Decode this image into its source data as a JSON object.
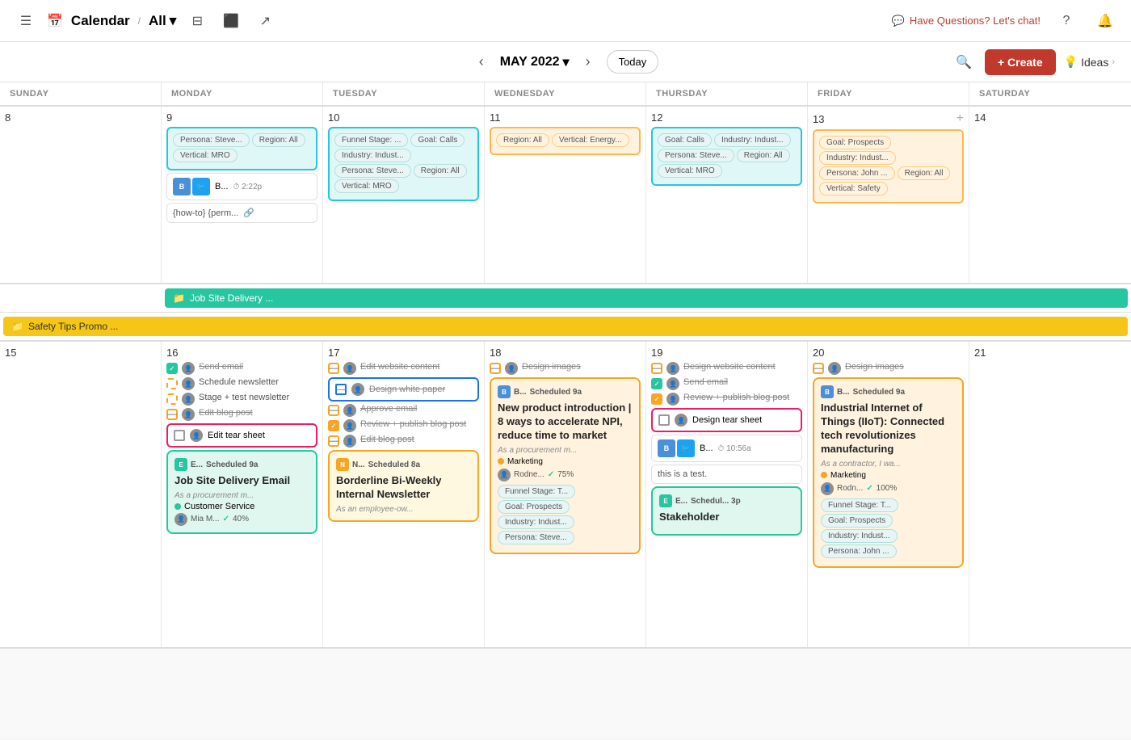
{
  "nav": {
    "menu_icon": "☰",
    "cal_icon": "▦",
    "title": "Calendar",
    "sep": "/",
    "all": "All",
    "chevron_down": "▾",
    "filter_icon": "⊟",
    "display_icon": "⬜",
    "share_icon": "↗",
    "chat_text": "Have Questions? Let's chat!",
    "help_icon": "?",
    "bell_icon": "🔔"
  },
  "controls": {
    "prev": "‹",
    "next": "›",
    "month_year": "MAY 2022",
    "today": "Today",
    "search_icon": "🔍",
    "create": "+ Create",
    "ideas_icon": "💡",
    "ideas": "Ideas"
  },
  "day_headers": [
    "SUNDAY",
    "MONDAY",
    "TUESDAY",
    "WEDNESDAY",
    "THURSDAY",
    "FRIDAY",
    "SATURDAY"
  ],
  "week1": {
    "dates": [
      8,
      9,
      10,
      11,
      12,
      13,
      14
    ],
    "sun": {
      "num": 8
    },
    "mon": {
      "num": 9,
      "tags": [
        "Persona: Steve...",
        "Region: All",
        "Vertical: MRO"
      ],
      "blog_label": "B...",
      "blog_time": "2:22p",
      "link_text": "{how-to} {perm...",
      "link_icon": "🔗"
    },
    "tue": {
      "num": 10,
      "tags_top": "Funnel Stage: ...",
      "tags": [
        "Goal: Calls",
        "Industry: Indust...",
        "Persona: Steve...",
        "Region: All",
        "Vertical: MRO"
      ]
    },
    "wed": {
      "num": 11,
      "tags": [
        "Region: All",
        "Vertical: Energy..."
      ]
    },
    "thu": {
      "num": 12,
      "tags": [
        "Goal: Calls",
        "Industry: Indust...",
        "Persona: Steve...",
        "Region: All",
        "Vertical: MRO"
      ]
    },
    "fri": {
      "num": 13,
      "plus": "+",
      "tags": [
        "Goal: Prospects",
        "Industry: Indust...",
        "Persona: John ...",
        "Region: All",
        "Vertical: Safety"
      ]
    },
    "sat": {
      "num": 14
    }
  },
  "allday1": {
    "icon": "📁",
    "text": "Job Site Delivery ..."
  },
  "allday2": {
    "icon": "📁",
    "text": "Safety Tips Promo ..."
  },
  "week2": {
    "sun": {
      "num": 15
    },
    "mon": {
      "num": 16,
      "tasks": [
        {
          "state": "checked",
          "label": "Send email",
          "strike": true
        },
        {
          "state": "dashed",
          "label": "Schedule newsletter",
          "strike": false
        },
        {
          "state": "dashed",
          "label": "Stage + test newsletter",
          "strike": false
        },
        {
          "state": "minus",
          "label": "Edit blog post",
          "strike": true
        },
        {
          "state": "tear",
          "label": "Edit tear sheet",
          "strike": false
        }
      ],
      "scheduled_label": "E...",
      "scheduled_time": "Scheduled 9a",
      "sched_title": "Job Site Delivery Email",
      "sched_sub": "As a procurement m...",
      "sched_dot_color": "green",
      "sched_tag": "Customer Service",
      "sched_author": "Mia M...",
      "sched_progress": "40%"
    },
    "tue": {
      "num": 17,
      "tasks": [
        {
          "state": "minus",
          "label": "Edit website content",
          "strike": true
        },
        {
          "state": "tear2",
          "label": "Design white paper",
          "strike": true
        },
        {
          "state": "minus",
          "label": "Approve email",
          "strike": true
        },
        {
          "state": "checked-orange",
          "label": "Review + publish blog post",
          "strike": true
        },
        {
          "state": "minus",
          "label": "Edit blog post",
          "strike": true
        }
      ],
      "scheduled_label": "N...",
      "scheduled_time": "Scheduled 8a",
      "sched_title": "Borderline Bi-Weekly Internal Newsletter",
      "sched_sub": "As an employee-ow..."
    },
    "wed": {
      "num": 18,
      "tasks": [
        {
          "state": "minus",
          "label": "Design images",
          "strike": true
        }
      ],
      "scheduled_label": "B...",
      "scheduled_time": "Scheduled 9a",
      "sched_title": "New product introduction | 8 ways to accelerate NPI, reduce time to market",
      "sched_sub": "As a procurement m...",
      "sched_tag": "Marketing",
      "sched_author": "Rodne...",
      "sched_progress": "75%",
      "sched_tags_bottom": [
        "Funnel Stage: T...",
        "Goal: Prospects",
        "Industry: Indust...",
        "Persona: Steve..."
      ]
    },
    "thu": {
      "num": 19,
      "tasks": [
        {
          "state": "minus",
          "label": "Design website content",
          "strike": true
        },
        {
          "state": "checked",
          "label": "Send email",
          "strike": true
        },
        {
          "state": "checked-orange",
          "label": "Review + publish blog post",
          "strike": true
        }
      ],
      "tear_label": "Design tear sheet",
      "blog_label": "B...",
      "blog_label2": "T...",
      "blog_time": "10:56a",
      "note_text": "this is a test.",
      "scheduled_label": "E...",
      "scheduled_time": "Schedul... 3p",
      "sched_title": "Stakeholder"
    },
    "fri": {
      "num": 20,
      "tasks": [
        {
          "state": "minus",
          "label": "Design images",
          "strike": true
        }
      ],
      "scheduled_label": "B...",
      "scheduled_time": "Scheduled 9a",
      "sched_title": "Industrial Internet of Things (IIoT): Connected tech revolutionizes manufacturing",
      "sched_sub": "As a contractor, I wa...",
      "sched_tag": "Marketing",
      "sched_author": "Rodn...",
      "sched_progress": "100%",
      "sched_tags_bottom": [
        "Funnel Stage: T...",
        "Goal: Prospects",
        "Industry: Indust...",
        "Persona: John ..."
      ]
    },
    "sat": {
      "num": 21
    }
  }
}
